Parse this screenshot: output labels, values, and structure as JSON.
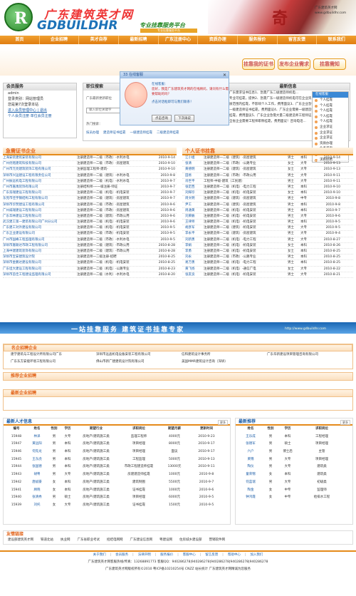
{
  "header": {
    "logo_letter": "R",
    "site_name_cn": "广东建筑英才网",
    "site_name_en": "GDBUILDHR",
    "slogan": "专业挂靠服务平台",
    "slogan_sub": "专业挂靠服务平台",
    "art_glyph": "奇",
    "art_text": "广东建筑英才网 www.gdbuildhr.com"
  },
  "nav": [
    "首页",
    "企业招聘",
    "英才自荐",
    "最新招聘",
    "广东注册中心",
    "资质办理",
    "服务报价",
    "留言反馈",
    "联系我们"
  ],
  "float_buttons": [
    "挂靠我的证书",
    "发布企业需求",
    "挂靠需知"
  ],
  "member": {
    "title": "会员服务",
    "username": "admin",
    "lines": [
      "登录类别：网站管理员",
      "您是第7次登录本站",
      "进入会员管理中心 | 退出",
      "个人会员注册    单位会员注册"
    ]
  },
  "search": {
    "title": "职位搜索",
    "hint": "广东最新更新职位",
    "placeholder": "输入职位关键字",
    "hot_label": "热门搜索：",
    "hot": [
      "技员办理",
      "建造师证书挂靠",
      "一级建造师挂靠",
      "二级建造师挂靠"
    ]
  },
  "popup": {
    "bar_title": "33 在线客服",
    "greeting": "在线客服：",
    "message": "您好，我是广东建筑英才网的在线顾问，请问有什么需要帮助的吗？",
    "hint": "点击对话框即可与我们联系！",
    "close_label": "关闭",
    "consult_label": "点击咨询",
    "later_label": "下次再说"
  },
  "news": {
    "title": "最新信息",
    "lines": [
      "广东需求证书信息1、急需广东二级建造师机电...",
      "专业可挂靠，提供2、急需广东一级建造师机电可在企业资...",
      "质范围内挂靠，不影响个人工作，费用面议3、广东企业急需...",
      "一级建造师证书挂靠，费用面议4、广东企业需要一级建造师...",
      "挂靠，费用面议5、广东企业急需大量二级建造师工程师证...",
      "全省企业需要工程师职称挂靠，费用面议！咨询电话..."
    ]
  },
  "online": {
    "title": "在线客服",
    "items": [
      "个人挂靠",
      "个人挂靠",
      "个人挂靠",
      "个人挂靠",
      "个人挂靠",
      "企业求证",
      "企业求证",
      "企业求证",
      "资质办理",
      "业务咨询",
      "挂靠咨询",
      "求职招聘",
      "求职招聘"
    ]
  },
  "left_list": {
    "title": "急需证书企业",
    "rows": [
      [
        "上海安装建筑安装有限公司",
        "注册建造师一二级（市政）-水利水电",
        "2010-9-14"
      ],
      [
        "广州优铭建筑科技有限公司",
        "注册建造师一二级（市政）-房屋建筑",
        "2010-9-10"
      ],
      [
        "广州市元亮建筑装饰工程有限公司",
        "注册监理工程师-建筑-",
        "2010-9-10"
      ],
      [
        "深圳市兴运建设工程有限责任公司",
        "注册建造师一二级（建筑）-水利水电",
        "2010-9-8"
      ],
      [
        "广州振远机电工程有限公司",
        "注册建造师一二级（机电）-水利水电",
        "2010-9-7"
      ],
      [
        "广州市嘉禹装饰有限公司",
        "注册结构师-一一级注册-师证",
        "2010-9-7"
      ],
      [
        "广东浩瑞建设工程有限公司",
        "注册建造师一二级（机电）-机电安装",
        "2010-9-7"
      ],
      [
        "东莞市佳宇钢结构工程有限公司",
        "注册建造师一二级（建筑）-房屋建筑",
        "2010-9-7"
      ],
      [
        "深圳市华赞建设工程有限公司",
        "注册建造师一二级（市政）-房屋建筑",
        "2010-9-6"
      ],
      [
        "广州威瑞建设工程有限公司",
        "注册建造师一二级（市政）-房屋建筑",
        "2010-9-6"
      ],
      [
        "广东华林建设工程有限公司",
        "注册建造师一二级（建筑）-市政公用",
        "2010-9-6"
      ],
      [
        "武汉建工第一建筑有限公司广州分公司",
        "注册建造师一二级（机电）-机电安装",
        "2010-9-6"
      ],
      [
        "广东建工对外建设有限公司",
        "注册建造师一二级（机电）-机电安装",
        "2010-9-5"
      ],
      [
        "广东正业建设有限公司",
        "注册建造师一二级（市政）-机电安装",
        "2010-9-5"
      ],
      [
        "广州市国峰工程监理有限公司",
        "注册建造师一二级（市政）-水利水电",
        "2010-9-5"
      ],
      [
        "深圳市嘉联达市政工程有限公司",
        "注册建造师一二级（建筑）-市政公用",
        "2010-8-28"
      ],
      [
        "上海中建建筑装饰有限公司",
        "注册建造师一二级（建筑）-市政公用",
        "2010-8-28"
      ],
      [
        "深圳市宝安建筑设计院",
        "注册建造师一二级注册-招聘",
        "2010-8-25"
      ],
      [
        "深圳市金鹏达建设有限公司",
        "注册建造师一二级（机电）-机电安装",
        "2010-8-25"
      ],
      [
        "广东坦大建设工程有限公司",
        "注册建造师一二级（机电）-公路专业",
        "2010-8-23"
      ],
      [
        "深圳市首佳工程建设监理有限公司",
        "注册建造师一二级（水利）-水利水电",
        "2010-8-20"
      ]
    ]
  },
  "right_list": {
    "title": "个人证书挂靠",
    "rows": [
      [
        "江小姐",
        "注册建造师一二级（建筑）-房屋建筑",
        "男士",
        "本科",
        "2010-9-14"
      ],
      [
        "张清",
        "注册建造师一二级（市政）-公路专业",
        "女士",
        "大专",
        "2010-9-13"
      ],
      [
        "黄德明",
        "注册建造师一二级（建筑）-房屋建筑",
        "女士",
        "大专",
        "2010-9-13"
      ],
      [
        "田易",
        "注册建造师一二级（市政）-市政公用",
        "男士",
        "大专",
        "2010-9-11"
      ],
      [
        "肖世平",
        "工程师-中级-建筑（工民建）",
        "男士",
        "大专",
        "2010-9-11"
      ],
      [
        "张定西",
        "注册建造师一二级（机电）-电力工程",
        "男士",
        "本科",
        "2010-9-10"
      ],
      [
        "刘辉珍",
        "注册建造师一二级（机电）-机电安装",
        "女士",
        "本科",
        "2010-9-10"
      ],
      [
        "周文明",
        "注册建造师一二级（建筑）-房屋建筑",
        "男士",
        "中专",
        "2010-9-8"
      ],
      [
        "尹工",
        "注册建造师一二级（建筑）-房屋建筑",
        "男士",
        "本科",
        "2010-9-8"
      ],
      [
        "周通黄",
        "注册建造师一二级（机电）-机电安装",
        "男士",
        "本科",
        "2010-9-7"
      ],
      [
        "刘黄敏",
        "注册建造师一二级（机电）-机电安装",
        "男士",
        "大专",
        "2010-9-6"
      ],
      [
        "王律师",
        "注册建造师一二级（机电）-机电安装",
        "男士",
        "本科",
        "2010-9-5"
      ],
      [
        "胡彦军",
        "注册建造师一二级（建筑）-机电安装",
        "男士",
        "大专",
        "2010-9-5"
      ],
      [
        "李永平",
        "注册建造师一二级（建筑）-房屋建筑",
        "男士",
        "大专",
        "2010-9-4"
      ],
      [
        "刘新勇",
        "注册建造师一二级（机电）-电力工程",
        "男士",
        "大专",
        "2010-8-27"
      ],
      [
        "李娟",
        "注册建造师一二级（机电）-机电安装",
        "女士",
        "本科",
        "2010-8-26"
      ],
      [
        "李勇",
        "注册建造师一二级（机电）-机电安装",
        "女士",
        "本科",
        "2010-8-25"
      ],
      [
        "刘永",
        "注册建造师一二级（市政）-公路专业",
        "男士",
        "本科",
        "2010-8-25"
      ],
      [
        "易万勇",
        "注册建造师一二级（机电）-电力工程",
        "男士",
        "本科",
        "2010-8-25"
      ],
      [
        "黄飞扬",
        "注册建造师一二级（机电）-通信广电",
        "女士",
        "大专",
        "2010-8-22"
      ],
      [
        "张友良",
        "注册建造师一二级（机电）-机电安装",
        "男士",
        "大专",
        "2010-8-21"
      ]
    ]
  },
  "ad_strip": {
    "text": "一站挂靠服务 建筑证书挂靠专家",
    "url": "http://www.gdbuildhr.com"
  },
  "famous": {
    "title": "名企招聘企业",
    "rows": [
      [
        "建学建筑与工程设计所有限公司广东",
        "深圳市远晶机电设备安装工程有限公司",
        "信和建筑设计事务所",
        "广东华新建设项目管理咨询有限公司"
      ],
      [
        "广东东方安能环境工程有限公司",
        "佛山市新广建建筑设计院有限公司",
        "美国MMR建筑设计咨询（深圳）"
      ]
    ]
  },
  "recommend_title": "推荐企业招聘",
  "hr_title": "最新企业招聘",
  "talent": {
    "title": "最新人才信息",
    "more": "更多",
    "headers": [
      "编号",
      "姓名",
      "性别",
      "学历",
      "期望行业",
      "求职岗位",
      "期望月薪",
      "更新时间"
    ],
    "rows": [
      [
        "15948",
        "林泽",
        "男",
        "大专",
        "房地产/建筑施工类",
        "监理工程师",
        "4000元",
        "2010-9-23"
      ],
      [
        "15947",
        "黄远阳",
        "男",
        "本科",
        "房地产/建筑施工类",
        "项目经理",
        "8000元",
        "2010-9-17"
      ],
      [
        "15946",
        "何先龙",
        "男",
        "本科",
        "房地产/建筑施工类",
        "项目经理",
        "面议",
        "2010-9-17"
      ],
      [
        "15945",
        "王东虎",
        "男",
        "本科",
        "房地产/建筑施工类",
        "工程监理",
        "5000元",
        "2010-9-13"
      ],
      [
        "15944",
        "张国德",
        "男",
        "本科",
        "房地产/建筑施工类",
        "市政工程建造师挂靠",
        "13000元",
        "2010-9-11"
      ],
      [
        "15943",
        "胡粤",
        "男",
        "大专",
        "房地产/建筑施工类",
        "房建建造师挂靠",
        "1000元",
        "2010-9-8"
      ],
      [
        "15942",
        "唐斌豪",
        "女",
        "本科",
        "房地产/建筑施工类",
        "建筑制图",
        "5500元",
        "2010-9-7"
      ],
      [
        "15941",
        "顾晓",
        "女",
        "本科",
        "房地产/建筑施工类",
        "证书挂靠",
        "1000元",
        "2010-9-6"
      ],
      [
        "15940",
        "张清秀",
        "男",
        "硕士",
        "房地产/建筑施工类",
        "项目经理",
        "6000元",
        "2010-9-5"
      ],
      [
        "15939",
        "刘托",
        "女",
        "大专",
        "房地产/建筑施工类",
        "证书挂靠",
        "1500元",
        "2010-9-5"
      ]
    ]
  },
  "latest": {
    "title": "最新推荐",
    "more": "更多",
    "headers": [
      "姓名",
      "性别",
      "学历",
      "求职岗位"
    ],
    "rows": [
      [
        "王乐成",
        "男",
        "本科",
        "工程经理"
      ],
      [
        "张德军",
        "男",
        "硕士",
        "项目经理"
      ],
      [
        "六户",
        "男",
        "博士后",
        "主管"
      ],
      [
        "黄锦",
        "男",
        "大专",
        "项目经理"
      ],
      [
        "陶仪",
        "男",
        "大专",
        "建筑类"
      ],
      [
        "童荣锦",
        "女",
        "本科",
        "建筑类"
      ],
      [
        "何蓝瑞",
        "男",
        "大专",
        "初级类"
      ],
      [
        "陶金",
        "女",
        "中专",
        "监理师"
      ],
      [
        "钟鸿霞",
        "女",
        "中专",
        "给排水工程"
      ]
    ]
  },
  "links": {
    "title": "友情链接",
    "items": [
      "建设部建筑英才网",
      "铁道北站",
      "执业网",
      "广东省职业考试",
      "招结电网网",
      "广东建设信息网",
      "粤建设网",
      "住房城乡建设部",
      "营销软件网"
    ]
  },
  "footer": {
    "nav": [
      "关于我们",
      "会员服务",
      "法律声明",
      "服务报价",
      "客服中心",
      "留言反馈",
      "帮助中心",
      "加入我们"
    ],
    "contact": "广东建筑英才网客服热线/传真：13268891773    客服QQ：940286278|940286278|940286278|940286278|940286278",
    "copyright": "广东建筑英才网版权所有©2010    粤ICP备10210254号    CNZZ 站长统计    广东建筑英才网精诚为您服务"
  }
}
